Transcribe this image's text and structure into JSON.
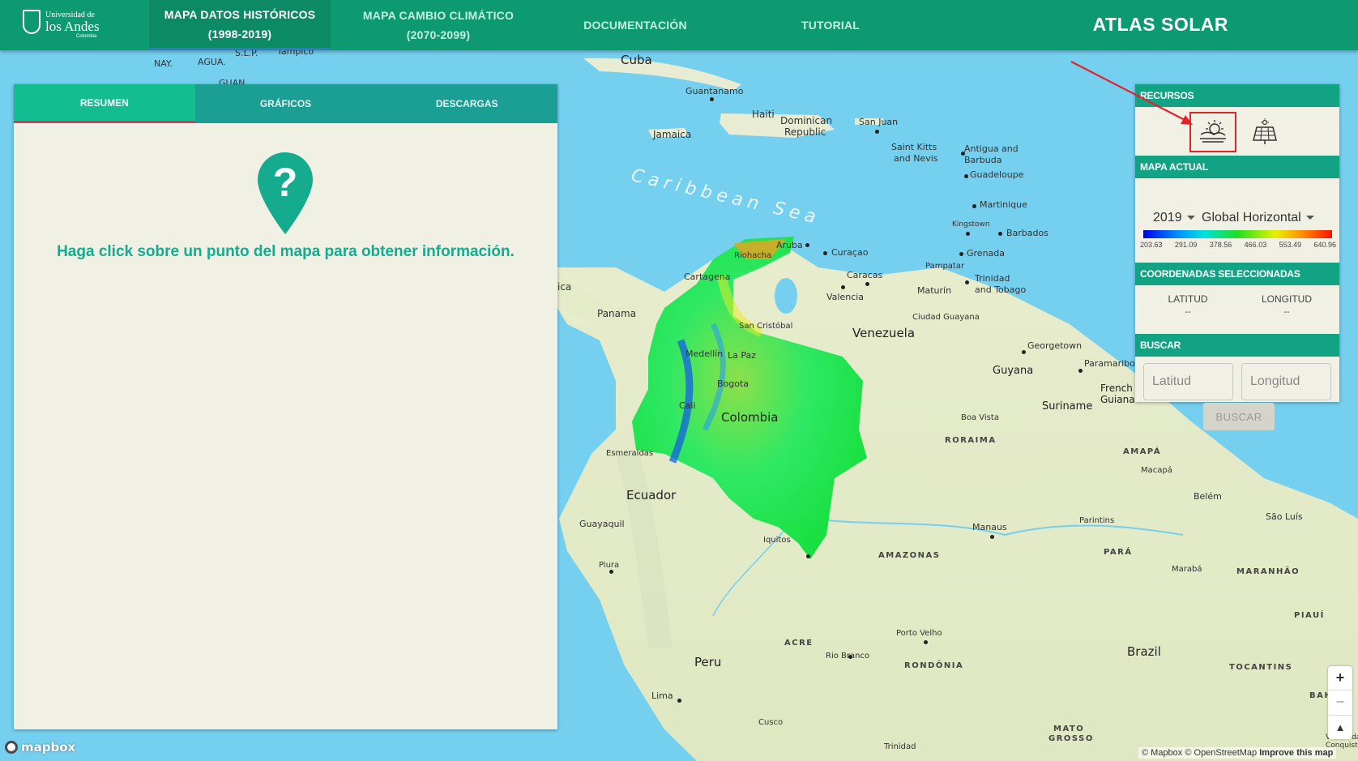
{
  "header": {
    "logo": {
      "line1": "Universidad de",
      "line2": "los Andes",
      "line3": "Colombia"
    },
    "tabs": [
      {
        "line1": "MAPA DATOS HISTÓRICOS",
        "line2": "(1998-2019)"
      },
      {
        "line1": "MAPA CAMBIO CLIMÁTICO",
        "line2": "(2070-2099)"
      },
      {
        "label": "DOCUMENTACIÓN"
      },
      {
        "label": "TUTORIAL"
      }
    ],
    "title": "ATLAS SOLAR"
  },
  "left_panel": {
    "tabs": [
      "RESUMEN",
      "GRÁFICOS",
      "DESCARGAS"
    ],
    "active_tab": "RESUMEN",
    "pin_icon": "question-mark-pin-icon",
    "message": "Haga click sobre un punto del mapa para obtener información."
  },
  "right_panel": {
    "resources_header": "RECURSOS",
    "resource_icons": [
      "solar-radiation-icon",
      "solar-panel-icon"
    ],
    "current_map_header": "MAPA ACTUAL",
    "year": "2019",
    "variable": "Global Horizontal",
    "colorbar_ticks": [
      "203.63",
      "291.09",
      "378.56",
      "466.03",
      "553.49",
      "640.96"
    ],
    "coords_header": "COORDENADAS SELECCIONADAS",
    "lat_label": "LATITUD",
    "lat_value": "--",
    "lon_label": "LONGITUD",
    "lon_value": "--",
    "search_header": "BUSCAR",
    "lat_placeholder": "Latitud",
    "lon_placeholder": "Longitud",
    "search_button": "BUSCAR"
  },
  "map": {
    "labels": {
      "cuba": "Cuba",
      "guantanamo": "Guantanamo",
      "haiti": "Haiti",
      "dominican": "Dominican",
      "republic": "Republic",
      "jamaica": "Jamaica",
      "sanjuan": "San Juan",
      "saintkitts": "Saint Kitts",
      "andnevis": "and Nevis",
      "antigua": "Antigua and",
      "barbuda": "Barbuda",
      "guadeloupe": "Guadeloupe",
      "martinique": "Martinique",
      "kingstown": "Kingstown",
      "barbados": "Barbados",
      "grenada": "Grenada",
      "caribbean": "Caribbean Sea",
      "aruba": "Aruba",
      "curacao": "Curaçao",
      "riohacha": "Riohacha",
      "cartagena": "Cartagena",
      "caracas": "Caracas",
      "valencia": "Valencia",
      "pampatar": "Pampatar",
      "maturin": "Maturín",
      "trinidad": "Trinidad",
      "andtobago": "and Tobago",
      "panama": "Panama",
      "sancristobal": "San Cristóbal",
      "venezuela": "Venezuela",
      "ciudadguayana": "Ciudad Guayana",
      "georgetown": "Georgetown",
      "paramaribo": "Paramaribo",
      "guyana": "Guyana",
      "french": "French",
      "guiana": "Guiana",
      "suriname": "Suriname",
      "medellin": "Medellín",
      "lapaz": "La Paz",
      "bogota": "Bogota",
      "cali": "Cali",
      "colombia": "Colombia",
      "boavista": "Boa Vista",
      "roraima": "RORAIMA",
      "amapa": "AMAPÁ",
      "macapa": "Macapá",
      "belem": "Belém",
      "saoluis": "São Luís",
      "esmeraldas": "Esmeraldas",
      "ecuador": "Ecuador",
      "guayaquil": "Guayaquil",
      "iquitos": "Iquitos",
      "manaus": "Manaus",
      "parintins": "Parintins",
      "amazonas": "AMAZONAS",
      "para": "PARÁ",
      "maraba": "Marabá",
      "maranhao": "MARANHÃO",
      "piaui": "PIAUÍ",
      "piura": "Piura",
      "acre": "ACRE",
      "portovelho": "Porto Velho",
      "riobranco": "Rio Branco",
      "rondonia": "RONDÔNIA",
      "brazil": "Brazil",
      "tocantins": "TOCANTINS",
      "peru": "Peru",
      "lima": "Lima",
      "cusco": "Cusco",
      "matogrosso1": "MATO",
      "matogrosso2": "GROSSO",
      "trinidadbo": "Trinidad",
      "bah": "BAH",
      "nay": "NAY.",
      "agua": "AGUA.",
      "slp": "S.L.P.",
      "tampico": "Tampico",
      "guan": "GUAN",
      "ica": "ica",
      "vitoria": "Vitória da",
      "conquista": "Conquista"
    }
  },
  "map_controls": {
    "zoom_in": "+",
    "zoom_out": "−",
    "compass": "▲",
    "mapbox_logo": "mapbox",
    "attribution": "© Mapbox © OpenStreetMap",
    "improve": "Improve this map"
  },
  "colors": {
    "brand_green": "#0e9a70",
    "panel_header": "#12a385",
    "accent_teal": "#14ab8f",
    "highlight_red": "#e0242c"
  }
}
